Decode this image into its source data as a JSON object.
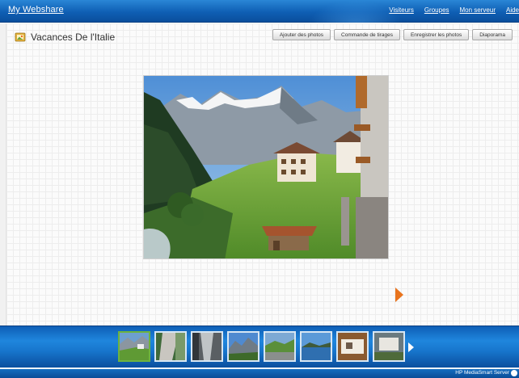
{
  "header": {
    "brand": "My Webshare",
    "nav": [
      "Visiteurs",
      "Groupes",
      "Mon serveur",
      "Aide"
    ]
  },
  "album": {
    "title": "Vacances De l'Italie",
    "icon": "album-trophy-icon"
  },
  "toolbar": {
    "add_photos": "Ajouter des photos",
    "order_prints": "Commande de tirages",
    "save_photos": "Enregistrer les photos",
    "slideshow": "Diaporama"
  },
  "viewer": {
    "next_icon": "next-arrow-icon",
    "photo_subject": "alpine village with mountains"
  },
  "filmstrip": {
    "thumbnail_count": 8,
    "selected_index": 0,
    "next_icon": "filmstrip-next-icon"
  },
  "footer": {
    "product": "HP MediaSmart Server"
  },
  "colors": {
    "bar_blue": "#0f5fb4",
    "accent_orange": "#e8741e",
    "selected_green": "#6db33f"
  }
}
